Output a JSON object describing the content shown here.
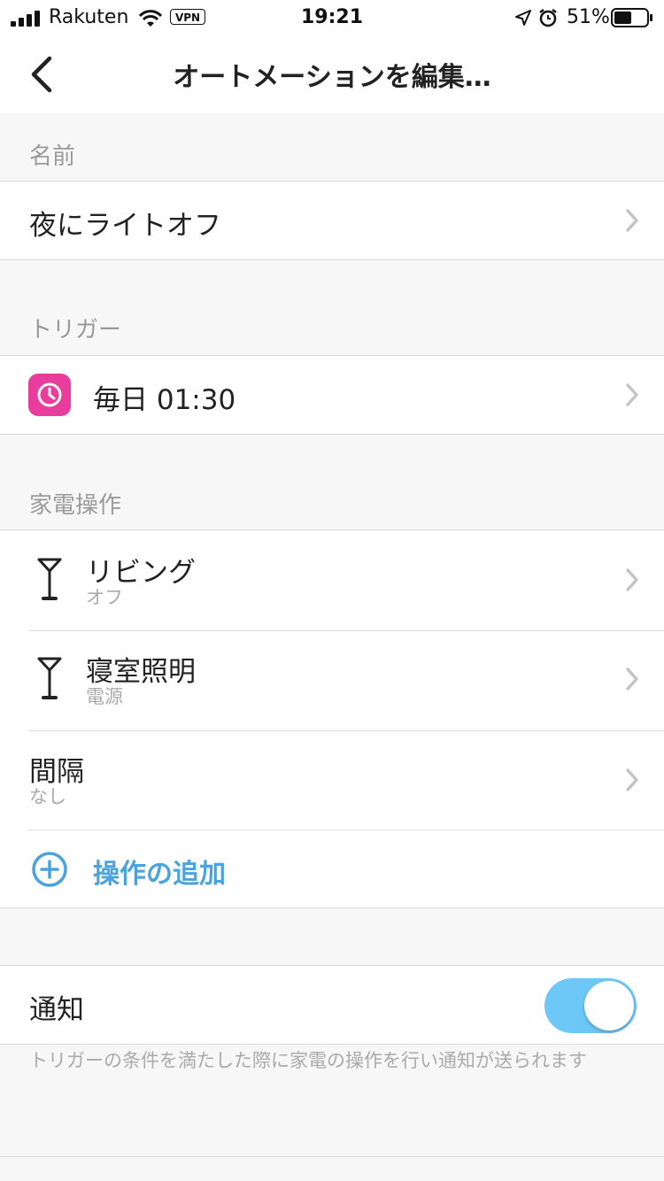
{
  "status_bar": {
    "carrier": "Rakuten",
    "vpn": "VPN",
    "time": "19:21",
    "battery": "51%"
  },
  "nav": {
    "title": "オートメーションを編集…",
    "back_icon": "chevron-left-icon"
  },
  "sections": {
    "name": {
      "header": "名前",
      "value": "夜にライトオフ"
    },
    "trigger": {
      "header": "トリガー",
      "value": "毎日 01:30",
      "icon": "clock-icon",
      "icon_color": "#e83d9c"
    },
    "operations": {
      "header": "家電操作",
      "items": [
        {
          "label": "リビング",
          "sub": "オフ",
          "icon": "lamp-icon"
        },
        {
          "label": "寝室照明",
          "sub": "電源",
          "icon": "lamp-icon"
        }
      ],
      "interval": {
        "label": "間隔",
        "sub": "なし"
      },
      "add_label": "操作の追加",
      "add_icon": "plus-circle-icon",
      "accent_color": "#4aa3dd"
    },
    "notification": {
      "label": "通知",
      "enabled": true,
      "toggle_color": "#6ec8f7",
      "note": "トリガーの条件を満たした際に家電の操作を行い通知が送られます"
    }
  }
}
